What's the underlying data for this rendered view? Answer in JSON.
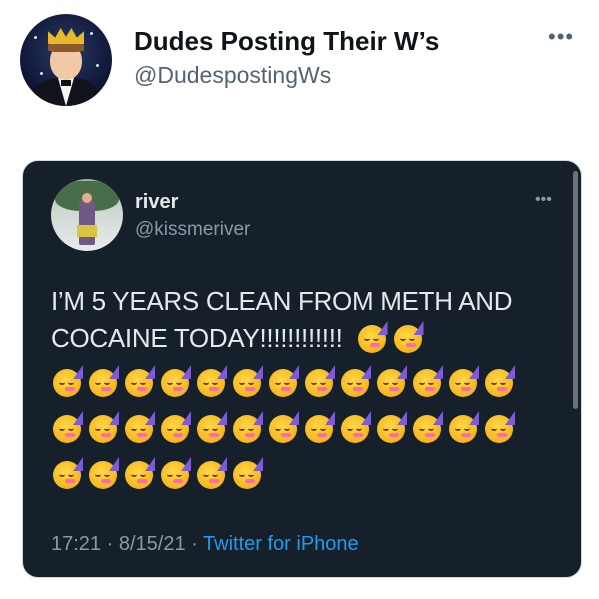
{
  "retweeter": {
    "display_name": "Dudes Posting Their W’s",
    "handle": "@DudespostingWs",
    "more_label": "•••",
    "avatar_icon": "crowned-man-avatar"
  },
  "embedded_tweet": {
    "author_name": "river",
    "author_handle": "@kissmeriver",
    "more_label": "•••",
    "text": "I’M 5 YEARS CLEAN FROM METH AND COCAINE TODAY!!!!!!!!!!!!",
    "emoji_icon": "partying-face-emoji",
    "emoji_rows": [
      2,
      13,
      13,
      6
    ],
    "time": "17:21",
    "date": "8/15/21",
    "separator": "·",
    "source": "Twitter for iPhone"
  },
  "colors": {
    "card_bg": "#15202b",
    "link": "#1d9bf0",
    "muted": "#8b98a5"
  }
}
